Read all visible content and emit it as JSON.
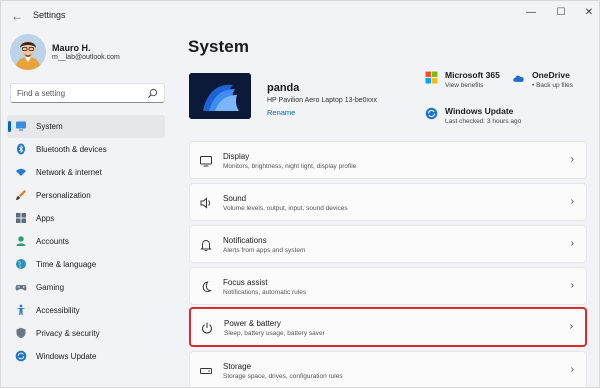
{
  "window": {
    "title": "Settings",
    "back_glyph": "←",
    "min_glyph": "—",
    "max_glyph": "☐",
    "close_glyph": "✕"
  },
  "user": {
    "name": "Mauro H.",
    "email": "m__lab@outlook.com"
  },
  "search": {
    "placeholder": "Find a setting",
    "icon": "search-icon"
  },
  "nav": {
    "items": [
      {
        "label": "System",
        "icon": "monitor-icon",
        "active": true
      },
      {
        "label": "Bluetooth & devices",
        "icon": "bluetooth-icon"
      },
      {
        "label": "Network & internet",
        "icon": "wifi-icon"
      },
      {
        "label": "Personalization",
        "icon": "brush-icon"
      },
      {
        "label": "Apps",
        "icon": "apps-icon"
      },
      {
        "label": "Accounts",
        "icon": "person-icon"
      },
      {
        "label": "Time & language",
        "icon": "globe-icon"
      },
      {
        "label": "Gaming",
        "icon": "controller-icon"
      },
      {
        "label": "Accessibility",
        "icon": "accessibility-icon"
      },
      {
        "label": "Privacy & security",
        "icon": "shield-icon"
      },
      {
        "label": "Windows Update",
        "icon": "update-icon"
      }
    ],
    "accent": "#0067c0"
  },
  "main": {
    "title": "System",
    "device": {
      "name": "panda",
      "model": "HP Pavilion Aero Laptop 13-be0xxx",
      "rename": "Rename"
    },
    "tiles": {
      "m365": {
        "title": "Microsoft 365",
        "sub": "View benefits"
      },
      "onedrive": {
        "title": "OneDrive",
        "sub": "• Back up files"
      },
      "update": {
        "title": "Windows Update",
        "sub": "Last checked: 3 hours ago"
      }
    },
    "cards": [
      {
        "title": "Display",
        "sub": "Monitors, brightness, night light, display profile",
        "icon": "display-icon"
      },
      {
        "title": "Sound",
        "sub": "Volume levels, output, input, sound devices",
        "icon": "speaker-icon"
      },
      {
        "title": "Notifications",
        "sub": "Alerts from apps and system",
        "icon": "bell-icon"
      },
      {
        "title": "Focus assist",
        "sub": "Notifications, automatic rules",
        "icon": "moon-icon"
      },
      {
        "title": "Power & battery",
        "sub": "Sleep, battery usage, battery saver",
        "icon": "power-icon",
        "highlighted": true
      },
      {
        "title": "Storage",
        "sub": "Storage space, drives, configuration rules",
        "icon": "storage-icon"
      }
    ],
    "chevron": "›",
    "highlight_color": "#d82b2b"
  }
}
